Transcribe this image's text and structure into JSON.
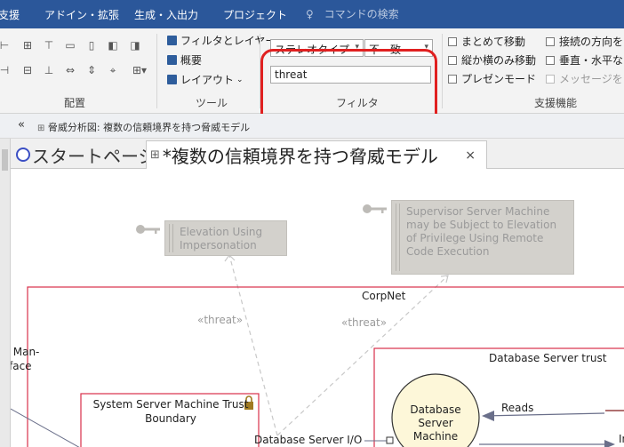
{
  "menubar": {
    "items": [
      "支援",
      "アドイン・拡張",
      "生成・入出力",
      "プロジェクト"
    ],
    "search_placeholder": "コマンドの検索"
  },
  "ribbon": {
    "groups": {
      "layout_label": "配置",
      "tools_label": "ツール",
      "filter_label": "フィルタ",
      "support_label": "支援機能"
    },
    "tools": {
      "filter_layer": "フィルタとレイヤー",
      "overview": "概要",
      "layout": "レイアウト"
    },
    "filter": {
      "type_select": "ステレオタイプ",
      "mode_select": "不一致",
      "text_value": "threat"
    },
    "support": {
      "move_together": "まとめて移動",
      "vertical_horizontal_move": "縦か横のみ移動",
      "presentation_mode": "プレゼンモード",
      "connection_direction": "接続の方向を",
      "vertical_horizontal": "垂直・水平な",
      "message_auto": "メッセージを自"
    }
  },
  "breadcrumb": {
    "path": "脅威分析図: 複数の信頼境界を持つ脅威モデル"
  },
  "tabs": {
    "start_page": "スタートページ",
    "active": "*複数の信頼境界を持つ脅威モデル",
    "close": "×"
  },
  "diagram": {
    "threat1": [
      "Elevation Using",
      "Impersonation"
    ],
    "threat2": [
      "Supervisor Server Machine",
      "may be Subject to Elevation",
      "of Privilege Using Remote",
      "Code Execution"
    ],
    "stereotype_label": "«threat»",
    "corpnet": "CorpNet",
    "db_trust": "Database Server trust",
    "sys_boundary": [
      "System Server Machine Trust",
      "Boundary"
    ],
    "partial_label": [
      "r Man-",
      "face"
    ],
    "db_process": [
      "Database",
      "Server",
      "Machine"
    ],
    "reads": "Reads",
    "db_io": "Database Server I/O",
    "right_partial": "In"
  },
  "colors": {
    "menubar": "#2b579a",
    "highlight": "#e02020",
    "boundary": "#d9304a",
    "process_fill": "#fdf7d9",
    "threat_fill": "#d3d1cc"
  }
}
